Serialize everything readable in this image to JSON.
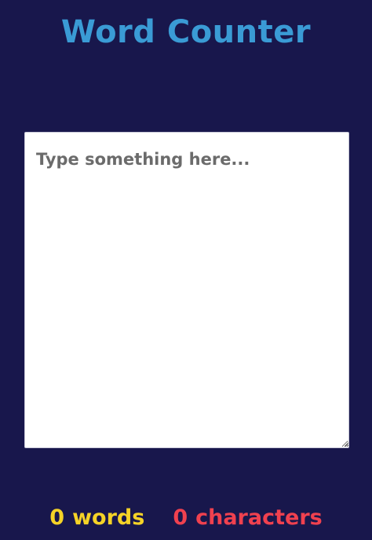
{
  "app": {
    "title": "Word Counter"
  },
  "editor": {
    "value": "",
    "placeholder": "Type something here..."
  },
  "stats": {
    "words_count": "0",
    "words_label": "words",
    "chars_count": "0",
    "chars_label": "characters"
  },
  "colors": {
    "background": "#18174c",
    "title": "#3a9bd5",
    "words": "#f5d327",
    "characters": "#f0414f",
    "editor_bg": "#ffffff",
    "placeholder": "#6b6b6b"
  },
  "icons": {
    "resize_grip": "resize-grip-icon"
  }
}
